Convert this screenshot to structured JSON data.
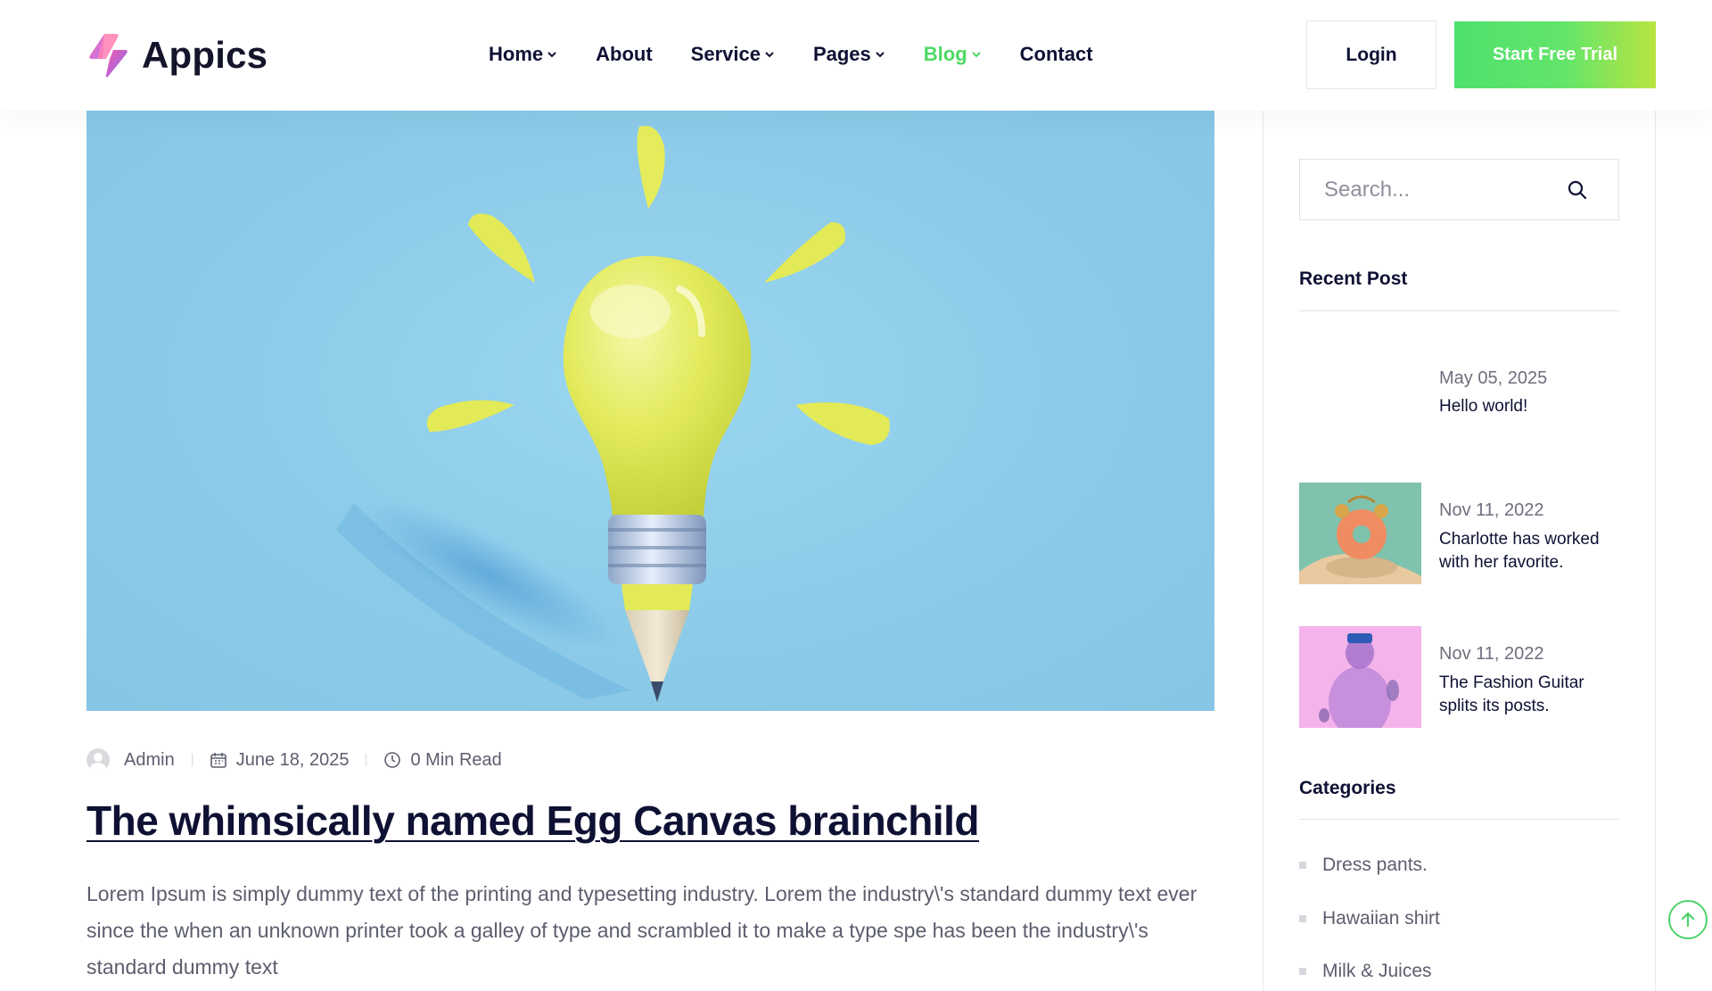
{
  "brand": {
    "name": "Appics"
  },
  "nav": {
    "items": [
      {
        "label": "Home",
        "has_dropdown": true,
        "active": false
      },
      {
        "label": "About",
        "has_dropdown": false,
        "active": false
      },
      {
        "label": "Service",
        "has_dropdown": true,
        "active": false
      },
      {
        "label": "Pages",
        "has_dropdown": true,
        "active": false
      },
      {
        "label": "Blog",
        "has_dropdown": true,
        "active": true
      },
      {
        "label": "Contact",
        "has_dropdown": false,
        "active": false
      }
    ],
    "active_color": "#4cd964"
  },
  "header": {
    "login_label": "Login",
    "trial_label": "Start Free Trial"
  },
  "post": {
    "author": "Admin",
    "date": "June 18, 2025",
    "read_time": "0 Min Read",
    "title": "The whimsically named Egg Canvas brainchild",
    "excerpt": "Lorem Ipsum is simply dummy text of the printing and typesetting industry. Lorem the industry\\'s standard dummy text ever since the when an unknown printer took a galley of type and scrambled it to make a type spe has been the industry\\'s standard dummy text",
    "image": "lightbulb-pencil-illustration"
  },
  "sidebar": {
    "search_placeholder": "Search...",
    "recent_title": "Recent Post",
    "recent_posts": [
      {
        "date": "May 05, 2025",
        "title": "Hello world!",
        "thumb": "none"
      },
      {
        "date": "Nov 11, 2022",
        "title": "Charlotte has worked with her favorite.",
        "thumb": "donut-alarm-clock"
      },
      {
        "date": "Nov 11, 2022",
        "title": "The Fashion Guitar splits its posts.",
        "thumb": "vr-figure-pink"
      }
    ],
    "categories_title": "Categories",
    "categories": [
      "Dress pants.",
      "Hawaiian shirt",
      "Milk & Juices"
    ]
  },
  "colors": {
    "accent_green": "#4cd964",
    "gradient_end": "#b9e441",
    "text_dark": "#0e1133",
    "text_muted": "#5c5e6e"
  }
}
